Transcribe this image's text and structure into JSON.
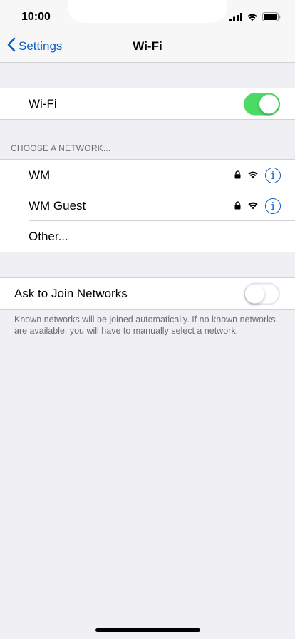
{
  "status_bar": {
    "time": "10:00"
  },
  "nav": {
    "back_label": "Settings",
    "title": "Wi-Fi"
  },
  "wifi": {
    "label": "Wi-Fi",
    "enabled": true
  },
  "networks": {
    "header": "CHOOSE A NETWORK...",
    "items": [
      {
        "name": "WM",
        "secured": true
      },
      {
        "name": "WM Guest",
        "secured": true
      }
    ],
    "other_label": "Other..."
  },
  "ask_to_join": {
    "label": "Ask to Join Networks",
    "enabled": false,
    "footer": "Known networks will be joined automatically. If no known networks are available, you will have to manually select a network."
  },
  "colors": {
    "accent": "#0a5dc2",
    "toggle_on": "#4cd964",
    "background": "#efeff4"
  },
  "icons": [
    "cellular-signal-icon",
    "wifi-status-icon",
    "battery-icon",
    "chevron-left-icon",
    "lock-icon",
    "wifi-signal-icon",
    "info-icon"
  ]
}
